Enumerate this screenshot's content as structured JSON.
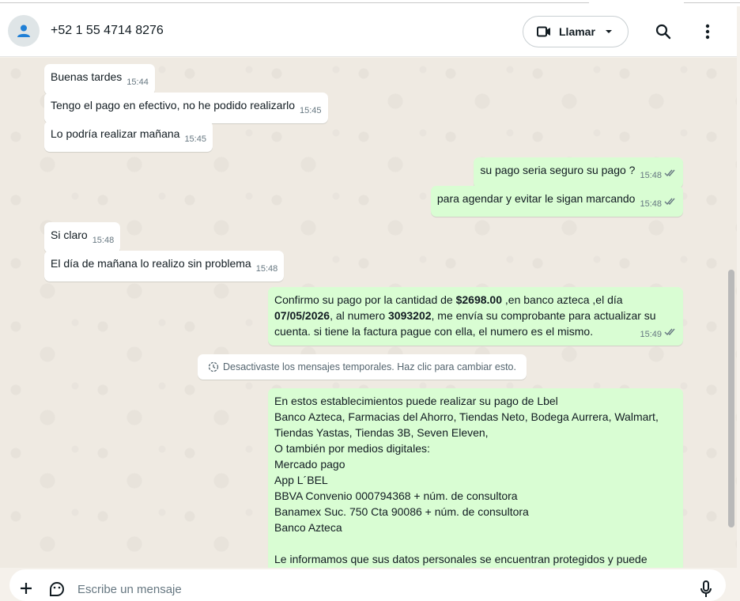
{
  "header": {
    "contact_name": "+52 1 55 4714 8276",
    "call_label": "Llamar",
    "icons": [
      "avatar-person-icon",
      "video-camera-icon",
      "chevron-down-icon",
      "search-icon",
      "more-vertical-icon"
    ]
  },
  "messages": [
    {
      "direction": "in",
      "text": "Buenas tardes",
      "time": "15:44"
    },
    {
      "direction": "in",
      "text": "Tengo el pago en efectivo, no he podido realizarlo",
      "time": "15:45"
    },
    {
      "direction": "in",
      "text": "Lo podría realizar mañana",
      "time": "15:45"
    },
    {
      "direction": "out",
      "text": "su pago seria seguro su pago ?",
      "time": "15:48"
    },
    {
      "direction": "out",
      "text": "para agendar y evitar le sigan marcando",
      "time": "15:48"
    },
    {
      "direction": "in",
      "text": "Si claro",
      "time": "15:48"
    },
    {
      "direction": "in",
      "text": "El día de mañana lo realizo sin problema",
      "time": "15:48"
    },
    {
      "direction": "out",
      "time": "15:49",
      "parts": {
        "p1": "Confirmo su  pago por la cantidad de ",
        "amount": "$2698.00",
        "p2": " ,en banco azteca ,el día",
        "date": "07/05/2026",
        "p3": ", al numero ",
        "number": "3093202",
        "p4": ", me envía su comprobante para actualizar su",
        "p5": "cuenta. si  tiene  la factura  pague con  ella,  el  numero  es el  mismo."
      }
    },
    {
      "direction": "out",
      "lines": [
        "En estos establecimientos puede realizar su pago de Lbel",
        "Banco Azteca, Farmacias del Ahorro, Tiendas Neto, Bodega Aurrera, Walmart,",
        "Tiendas Yastas, Tiendas 3B, Seven Eleven,",
        "O también por medios digitales:",
        "Mercado pago",
        "App L´BEL",
        "BBVA Convenio 000794368 + núm. de consultora",
        "Banamex Suc. 750 Cta 90086  + núm. de consultora",
        "Banco Azteca",
        "",
        "Le informamos que sus datos personales se encuentran protegidos y puede"
      ]
    }
  ],
  "system_notice": "Desactivaste los mensajes temporales. Haz clic para cambiar esto.",
  "composer": {
    "placeholder": "Escribe un mensaje",
    "icons": [
      "plus-icon",
      "sticker-icon",
      "microphone-icon"
    ]
  },
  "colors": {
    "incoming_bubble": "#ffffff",
    "outgoing_bubble": "#d9fdd3",
    "chat_background": "#efeae2",
    "read_ticks": "#667781"
  }
}
